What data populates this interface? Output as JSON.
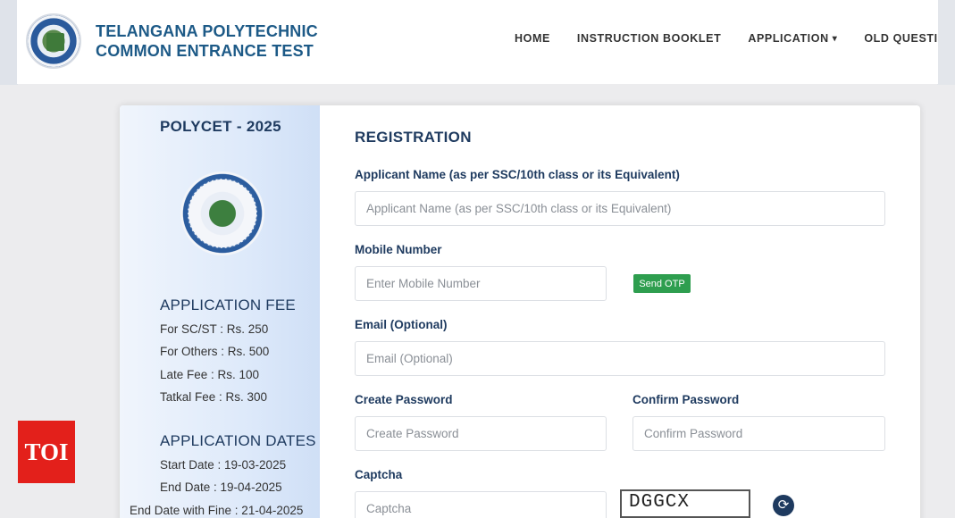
{
  "header": {
    "brand_line1": "TELANGANA POLYTECHNIC",
    "brand_line2": "COMMON ENTRANCE TEST",
    "nav": [
      {
        "label": "HOME"
      },
      {
        "label": "INSTRUCTION BOOKLET"
      },
      {
        "label": "APPLICATION"
      },
      {
        "label": "OLD QUESTI"
      }
    ]
  },
  "sidebar": {
    "title": "POLYCET - 2025",
    "fee_heading": "APPLICATION FEE",
    "fees": [
      "For SC/ST : Rs. 250",
      "For Others : Rs. 500",
      "Late Fee : Rs. 100",
      "Tatkal Fee : Rs. 300"
    ],
    "dates_heading": "APPLICATION DATES",
    "dates": [
      "Start Date : 19-03-2025",
      "End Date : 19-04-2025",
      "End Date with Fine : 21-04-2025"
    ]
  },
  "form": {
    "title": "REGISTRATION",
    "applicant_label": "Applicant Name (as per SSC/10th class or its Equivalent)",
    "applicant_placeholder": "Applicant Name (as per SSC/10th class or its Equivalent)",
    "mobile_label": "Mobile Number",
    "mobile_placeholder": "Enter Mobile Number",
    "otp_button": "Send OTP",
    "email_label": "Email (Optional)",
    "email_placeholder": "Email (Optional)",
    "password_label": "Create Password",
    "password_placeholder": "Create Password",
    "confirm_label": "Confirm Password",
    "confirm_placeholder": "Confirm Password",
    "captcha_label": "Captcha",
    "captcha_placeholder": "Captcha",
    "captcha_text": "DGGCX"
  },
  "badge": {
    "text": "TOI"
  },
  "colors": {
    "accent": "#1e3a5f",
    "otp": "#2e9e4f",
    "badge": "#e3201b"
  }
}
